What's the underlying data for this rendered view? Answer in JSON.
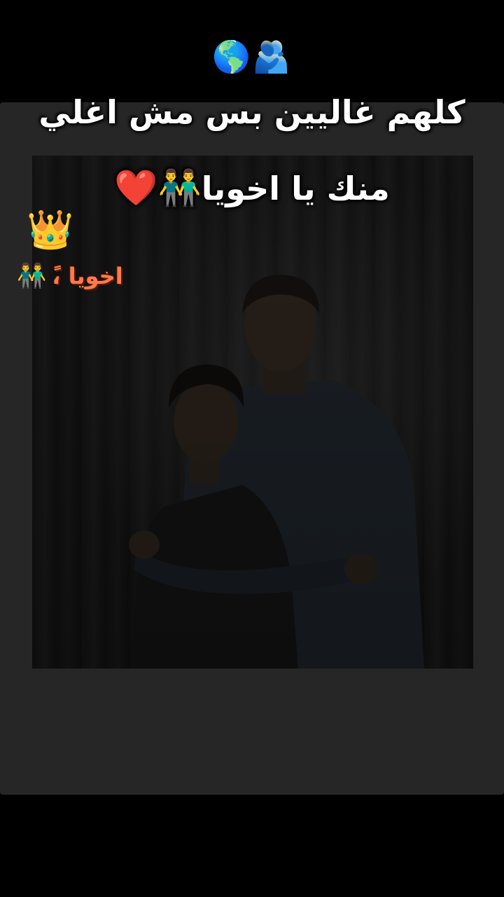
{
  "header": {
    "emoji": "🌎🫂"
  },
  "caption": {
    "line1": "كلهم غاليين بس مش اغلي",
    "line2_text": "منك يا اخويا",
    "line2_emoji": "👬❤️"
  },
  "stickers": {
    "crown_emoji": "👑",
    "label_text": "اخويا ،ً",
    "label_emoji": "👬",
    "label_color": "#ff7a4a"
  },
  "photo": {
    "description_colors": {
      "background": "#262626",
      "photo_dark": "#141414"
    }
  }
}
